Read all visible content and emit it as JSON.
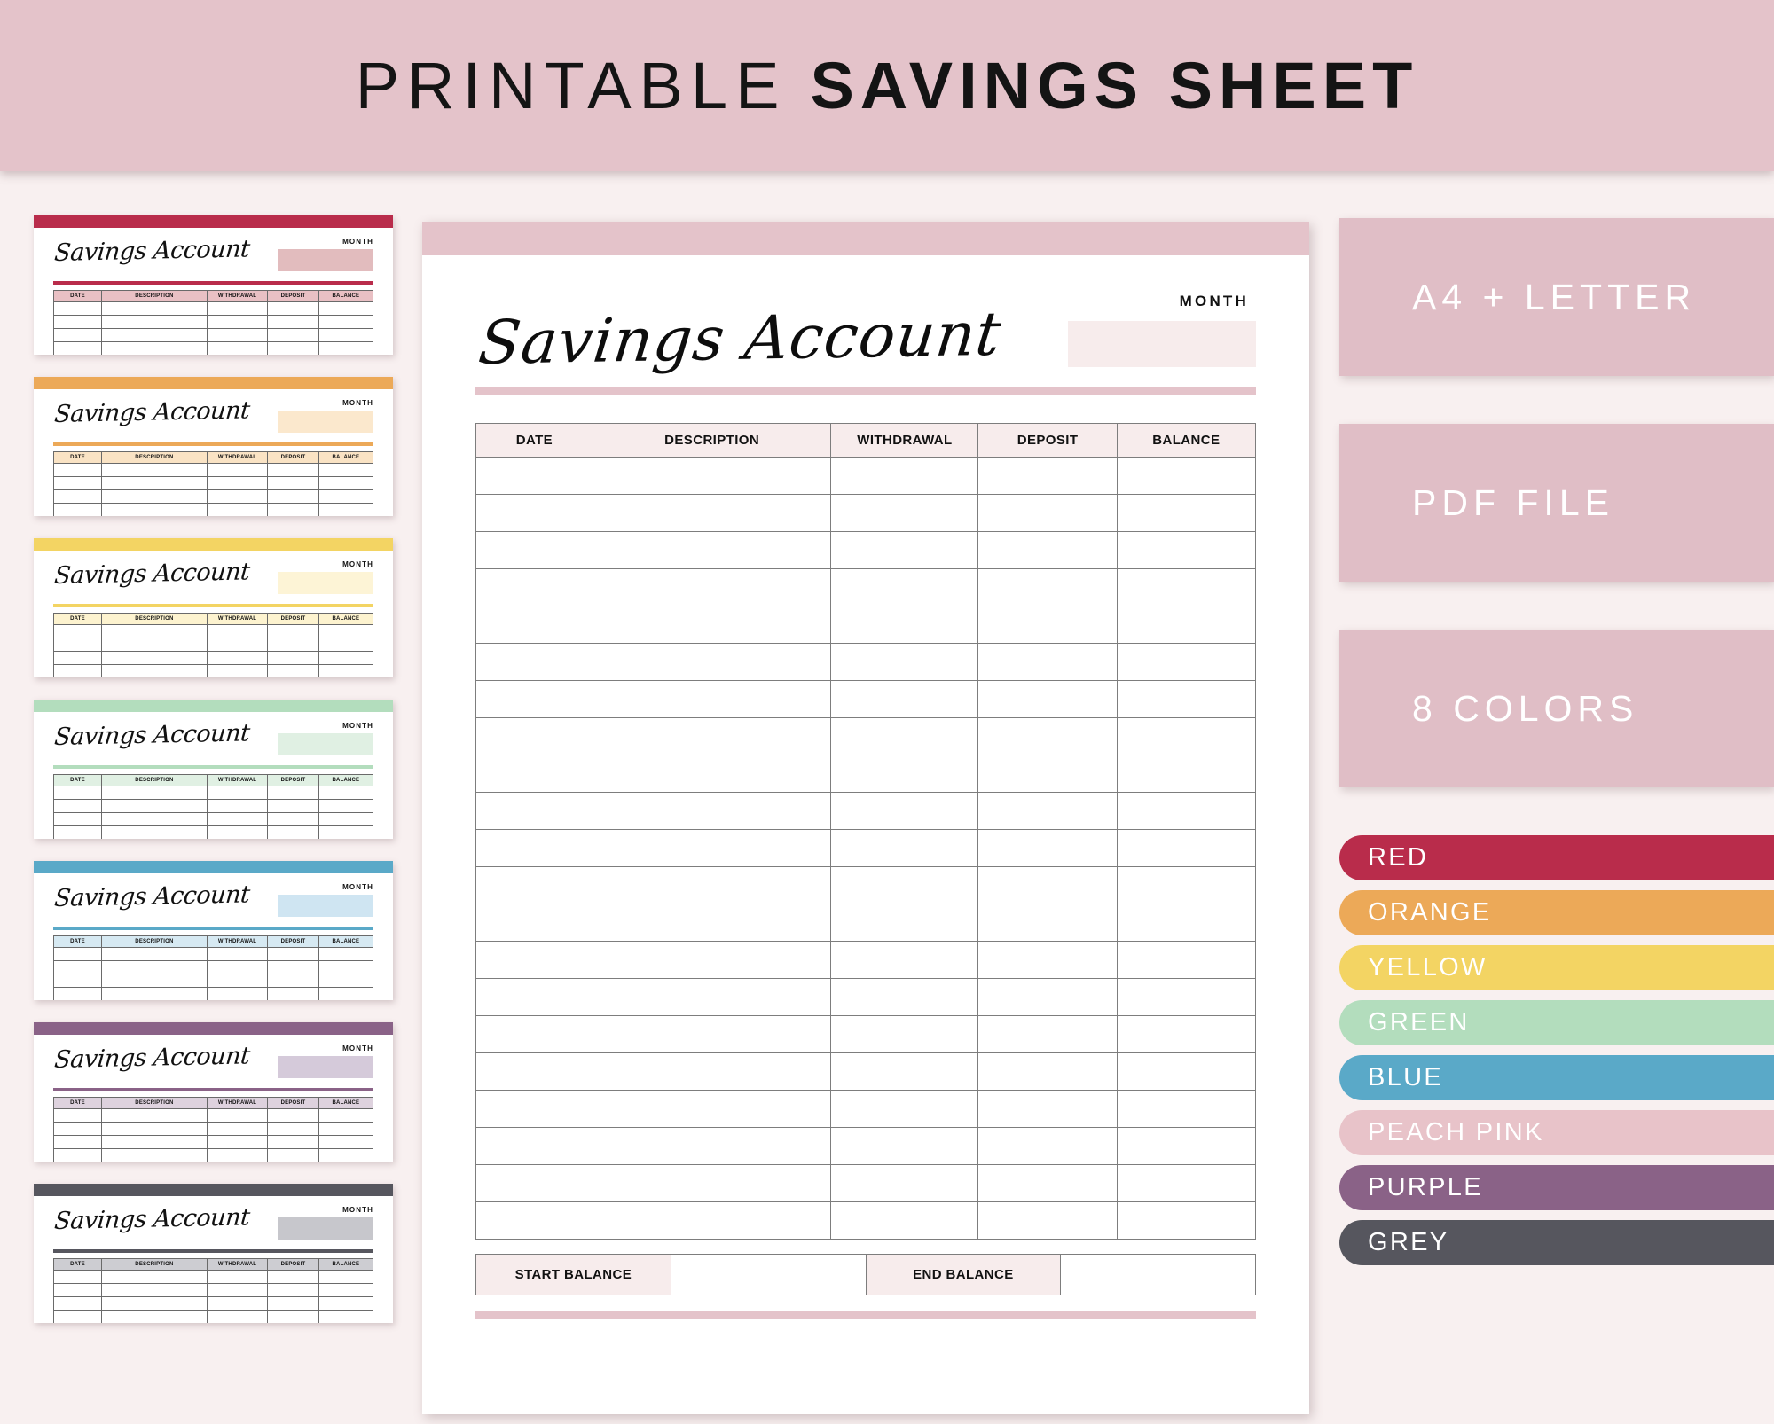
{
  "header": {
    "title_light": "PRINTABLE",
    "title_bold": "SAVINGS SHEET"
  },
  "sheet": {
    "title": "Savings Account",
    "month_label": "MONTH",
    "month_value": "",
    "columns": [
      "DATE",
      "DESCRIPTION",
      "WITHDRAWAL",
      "DEPOSIT",
      "BALANCE"
    ],
    "row_count": 21,
    "start_balance_label": "START BALANCE",
    "start_balance_value": "",
    "end_balance_label": "END BALANCE",
    "end_balance_value": "",
    "accent": "#e4c3ca",
    "header_fill": "#f7ecec"
  },
  "thumbnails": [
    {
      "name": "red",
      "bar": "#b92c4b",
      "fill": "#e9c0c4",
      "line": "#b92c4b",
      "box": "#e2bcbe"
    },
    {
      "name": "orange",
      "bar": "#eca958",
      "fill": "#fae3c4",
      "line": "#eca958",
      "box": "#fbe8cd"
    },
    {
      "name": "yellow",
      "bar": "#f3d463",
      "fill": "#fdf3cf",
      "line": "#f3d463",
      "box": "#fdf4d6"
    },
    {
      "name": "green",
      "bar": "#b3ddbd",
      "fill": "#e0f0e3",
      "line": "#b3ddbd",
      "box": "#e0f0e3"
    },
    {
      "name": "blue",
      "bar": "#5aa9c8",
      "fill": "#d6e9f2",
      "line": "#5aa9c8",
      "box": "#cfe5f2"
    },
    {
      "name": "purple",
      "bar": "#8a6287",
      "fill": "#ded2de",
      "line": "#8a6287",
      "box": "#d5cada"
    },
    {
      "name": "grey",
      "bar": "#56565e",
      "fill": "#cdcdd2",
      "line": "#56565e",
      "box": "#c7c7cc"
    }
  ],
  "features": [
    {
      "label": "A4 + LETTER"
    },
    {
      "label": "PDF FILE"
    },
    {
      "label": "8 COLORS"
    }
  ],
  "colors": [
    {
      "label": "RED",
      "hex": "#b92c4b"
    },
    {
      "label": "ORANGE",
      "hex": "#eca958"
    },
    {
      "label": "YELLOW",
      "hex": "#f3d463"
    },
    {
      "label": "GREEN",
      "hex": "#b3ddbd"
    },
    {
      "label": "BLUE",
      "hex": "#5aa9c8"
    },
    {
      "label": "PEACH PINK",
      "hex": "#e8c3c9"
    },
    {
      "label": "PURPLE",
      "hex": "#8a6287"
    },
    {
      "label": "GREY",
      "hex": "#56565e"
    }
  ]
}
